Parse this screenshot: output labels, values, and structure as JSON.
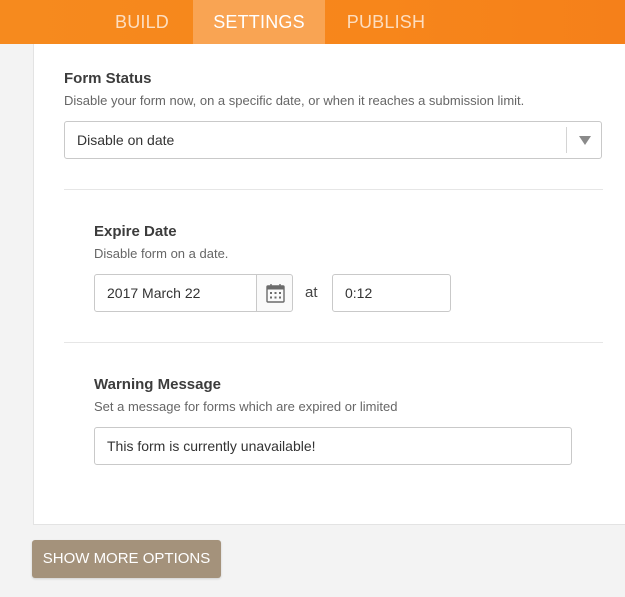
{
  "tabs": [
    {
      "label": "BUILD",
      "active": false
    },
    {
      "label": "SETTINGS",
      "active": true
    },
    {
      "label": "PUBLISH",
      "active": false
    }
  ],
  "form_status": {
    "label": "Form Status",
    "description": "Disable your form now, on a specific date, or when it reaches a submission limit.",
    "selected": "Disable on date"
  },
  "expire_date": {
    "label": "Expire Date",
    "description": "Disable form on a date.",
    "date_value": "2017 March 22",
    "at_label": "at",
    "time_value": "0:12"
  },
  "warning_message": {
    "label": "Warning Message",
    "description": "Set a message for forms which are expired or limited",
    "value": "This form is currently unavailable!"
  },
  "show_more_label": "SHOW MORE OPTIONS",
  "colors": {
    "brand_orange": "#f68a1e",
    "active_tab": "#f9a453",
    "button_tan": "#a4927b"
  },
  "icons": {
    "calendar": "calendar-icon",
    "dropdown": "chevron-down-icon"
  }
}
